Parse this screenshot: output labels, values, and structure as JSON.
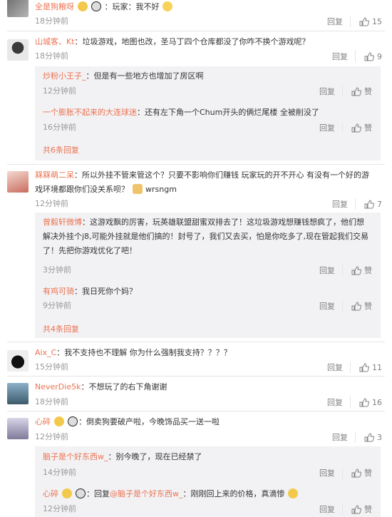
{
  "c1": {
    "name": "全是狗粮呀",
    "text": "：玩家：我不好",
    "time": "18分钟前",
    "reply": "回复",
    "likes": "15"
  },
  "c2": {
    "name": "山城客、Kt",
    "text": "：垃圾游戏，地图也改，圣马丁四个仓库都没了你咋不换个游戏呢？",
    "time": "18分钟前",
    "reply": "回复",
    "likes": "9",
    "subs": [
      {
        "name": "炒粉小王子_",
        "text": "：但是有一些地方也增加了房区啊",
        "time": "12分钟前",
        "reply": "回复",
        "like": "赞"
      },
      {
        "name": "一个膨胀不起来的大连球迷",
        "text": "：还有左下角一个Chum开头的俩烂尾楼 全被削没了",
        "time": "16分钟前",
        "reply": "回复",
        "like": "赞"
      }
    ],
    "more": "共6条回复"
  },
  "c3": {
    "name": "槑槑萌二呆",
    "text1": "：所以外挂不管来管这个？只要不影响你们赚钱 玩家玩的开不开心 有没有一个好的游",
    "text2": "戏环境都跟你们没关系呗？",
    "text2b": "wrsngm",
    "time": "12分钟前",
    "reply": "回复",
    "likes": "7",
    "subs": [
      {
        "name": "曾毅轩微博",
        "text1": "：这游戏飘的厉害，玩英雄联盟甜蜜双排去了！这垃圾游戏想赚钱想疯了，他们想",
        "text2": "解决外挂个j8,可能外挂就是他们搞的！封号了，我们又去买，怕是你吃多了,现在管起我们交易",
        "text3": "了！先把你游戏优化了吧！",
        "time": "3分钟前",
        "reply": "回复",
        "like": "赞"
      },
      {
        "name": "有鸡可骑",
        "text": "：我日死你个妈？",
        "time": "9分钟前",
        "reply": "回复",
        "like": "赞"
      }
    ],
    "more": "共4条回复"
  },
  "c4": {
    "name": "Aix_C",
    "text": "：我不支持也不理解 你为什么强制我支持？？？？",
    "time": "15分钟前",
    "reply": "回复",
    "likes": "11"
  },
  "c5": {
    "name": "NeverDie5k",
    "text": "：不想玩了的右下角谢谢",
    "time": "18分钟前",
    "reply": "回复",
    "likes": "16"
  },
  "c6": {
    "name": "心碎",
    "text": "：倒卖狗要破产啦，今晚饰品买一送一啦",
    "time": "12分钟前",
    "reply": "回复",
    "likes": "3",
    "subs": [
      {
        "name": "脑子是个好东西w_",
        "text": "：别今晚了，现在已经禁了",
        "time": "14分钟前",
        "reply": "回复",
        "like": "赞"
      },
      {
        "name": "心碎",
        "text": "：回复",
        "mention": "@脑子是个好东西w_",
        "text2": "：刚刚回上来的价格，真滴惨",
        "time": "12分钟前",
        "reply": "回复",
        "like": "赞"
      }
    ]
  }
}
